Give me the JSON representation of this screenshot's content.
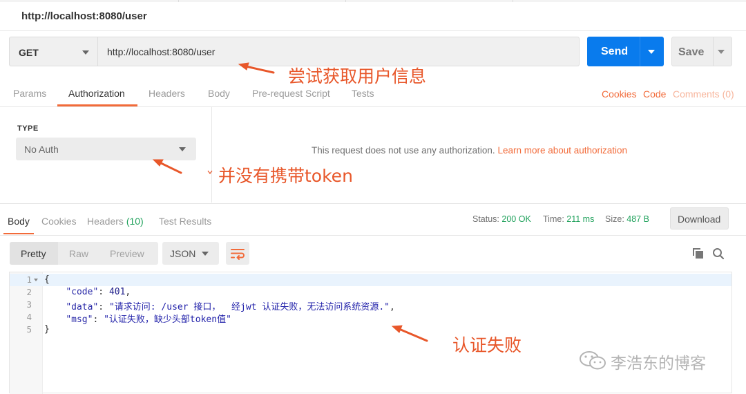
{
  "request_title": "http://localhost:8080/user",
  "url_bar": {
    "method": "GET",
    "url": "http://localhost:8080/user",
    "send_label": "Send",
    "save_label": "Save"
  },
  "request_tabs": {
    "items": [
      "Params",
      "Authorization",
      "Headers",
      "Body",
      "Pre-request Script",
      "Tests"
    ],
    "active": "Authorization",
    "right_links": [
      "Cookies",
      "Code",
      "Comments (0)"
    ]
  },
  "auth": {
    "type_label": "TYPE",
    "type_value": "No Auth",
    "message": "This request does not use any authorization.",
    "learn_more": "Learn more about authorization"
  },
  "response_tabs": {
    "body": "Body",
    "cookies": "Cookies",
    "headers": "Headers",
    "headers_count": "(10)",
    "test_results": "Test Results"
  },
  "response_status": {
    "status_label": "Status:",
    "status_value": "200 OK",
    "time_label": "Time:",
    "time_value": "211 ms",
    "size_label": "Size:",
    "size_value": "487 B",
    "download_label": "Download"
  },
  "viewer": {
    "modes": [
      "Pretty",
      "Raw",
      "Preview"
    ],
    "active_mode": "Pretty",
    "format": "JSON"
  },
  "code": {
    "line_numbers": [
      "1",
      "2",
      "3",
      "4",
      "5"
    ],
    "l1": "{",
    "code_key": "\"code\"",
    "code_val": "401",
    "data_key": "\"data\"",
    "data_val": "\"请求访问: /user 接口，  经jwt 认证失败，无法访问系统资源.\"",
    "msg_key": "\"msg\"",
    "msg_val": "\"认证失败，缺少头部token值\"",
    "l5": "}"
  },
  "annotations": {
    "a1": "尝试获取用户信息",
    "a2": "并没有携带token",
    "a3": "认证失败"
  },
  "watermark": "李浩东的博客",
  "colors": {
    "accent": "#f26b3a",
    "send_blue": "#097bed",
    "status_green": "#1fa15b",
    "annotation_red": "#e8572a"
  }
}
